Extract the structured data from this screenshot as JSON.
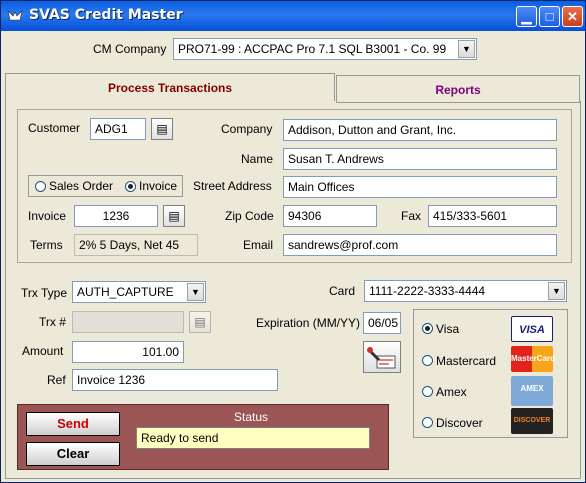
{
  "window": {
    "title": "SVAS Credit Master",
    "min_icon": "minimize-icon",
    "max_icon": "maximize-icon",
    "close_icon": "close-icon"
  },
  "company": {
    "label": "CM Company",
    "value": "PRO71-99  :  ACCPAC Pro 7.1 SQL B3001 - Co. 99"
  },
  "tabs": [
    {
      "label": "Process Transactions"
    },
    {
      "label": "Reports"
    }
  ],
  "customer": {
    "customer_label": "Customer",
    "customer_value": "ADG1",
    "company_label": "Company",
    "company_value": "Addison, Dutton and Grant, Inc.",
    "name_label": "Name",
    "name_value": "Susan T. Andrews",
    "street_label": "Street Address",
    "street_value": "Main Offices",
    "zip_label": "Zip Code",
    "zip_value": "94306",
    "fax_label": "Fax",
    "fax_value": "415/333-5601",
    "email_label": "Email",
    "email_value": "sandrews@prof.com",
    "sales_order_label": "Sales Order",
    "invoice_radio_label": "Invoice",
    "invoice_label": "Invoice",
    "invoice_value": "1236",
    "terms_label": "Terms",
    "terms_value": "2% 5 Days, Net 45"
  },
  "transaction": {
    "trx_type_label": "Trx Type",
    "trx_type_value": "AUTH_CAPTURE",
    "trx_num_label": "Trx #",
    "trx_num_value": "",
    "amount_label": "Amount",
    "amount_value": "101.00",
    "ref_label": "Ref",
    "ref_value": "Invoice 1236",
    "card_label": "Card",
    "card_value": "1111-2222-3333-4444",
    "exp_label": "Expiration (MM/YY)",
    "exp_value": "06/05"
  },
  "card_types": [
    {
      "label": "Visa",
      "logo": "VISA",
      "selected": true
    },
    {
      "label": "Mastercard",
      "logo": "MasterCard",
      "selected": false
    },
    {
      "label": "Amex",
      "logo": "AMEX",
      "selected": false
    },
    {
      "label": "Discover",
      "logo": "DISCOVER",
      "selected": false
    }
  ],
  "actions": {
    "send": "Send",
    "clear": "Clear"
  },
  "status": {
    "label": "Status",
    "value": "Ready to send"
  },
  "colors": {
    "title_bar": "#0a5fe0",
    "send_text": "#cc0000",
    "status_panel": "#9c5555",
    "status_field": "#ffffc0",
    "active_tab": "#800000",
    "inactive_tab": "#800080"
  }
}
